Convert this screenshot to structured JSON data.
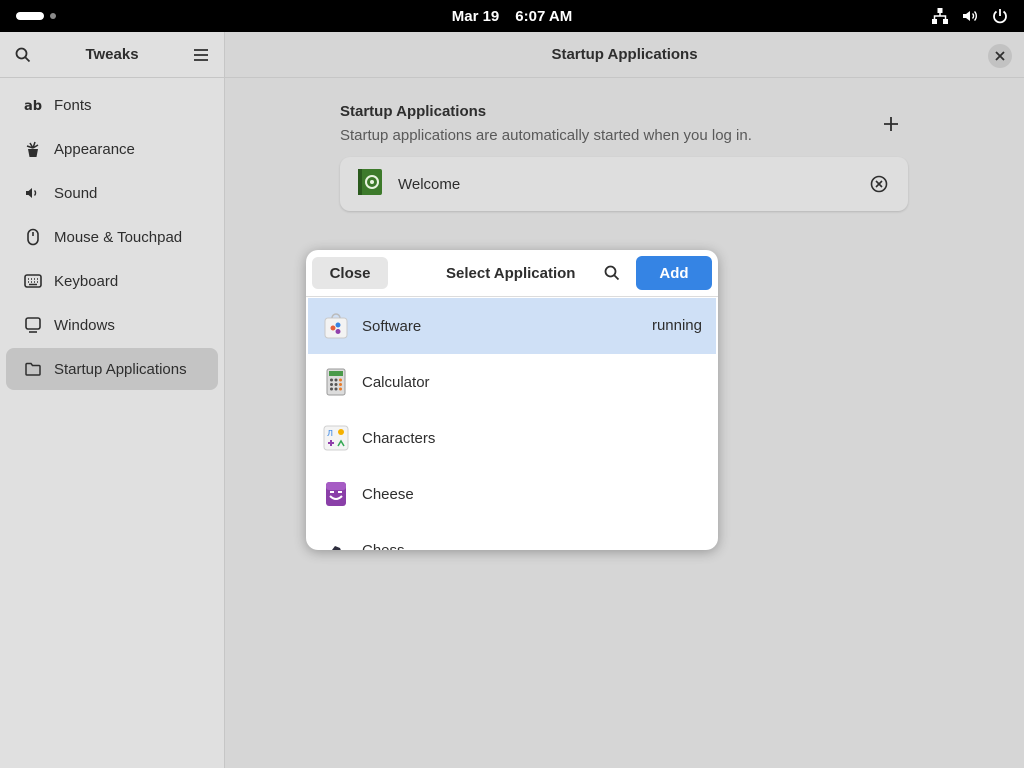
{
  "topbar": {
    "date": "Mar 19",
    "time": "6:07 AM",
    "icons": [
      "network-icon",
      "volume-icon",
      "power-icon"
    ]
  },
  "sidebar": {
    "title": "Tweaks",
    "items": [
      {
        "label": "Fonts",
        "icon": "fonts-icon"
      },
      {
        "label": "Appearance",
        "icon": "appearance-icon"
      },
      {
        "label": "Sound",
        "icon": "sound-icon"
      },
      {
        "label": "Mouse & Touchpad",
        "icon": "mouse-icon"
      },
      {
        "label": "Keyboard",
        "icon": "keyboard-icon"
      },
      {
        "label": "Windows",
        "icon": "windows-icon"
      },
      {
        "label": "Startup Applications",
        "icon": "folder-icon",
        "active": true
      }
    ]
  },
  "content": {
    "title": "Startup Applications",
    "section_title": "Startup Applications",
    "section_desc": "Startup applications are automatically started when you log in.",
    "apps": [
      {
        "label": "Welcome",
        "icon": "welcome-icon"
      }
    ]
  },
  "dialog": {
    "close_label": "Close",
    "title": "Select Application",
    "add_label": "Add",
    "items": [
      {
        "label": "Software",
        "status": "running",
        "selected": true
      },
      {
        "label": "Calculator"
      },
      {
        "label": "Characters"
      },
      {
        "label": "Cheese"
      },
      {
        "label": "Chess"
      }
    ]
  },
  "colors": {
    "accent": "#3584e4",
    "selected_row": "#cfe0f6"
  }
}
